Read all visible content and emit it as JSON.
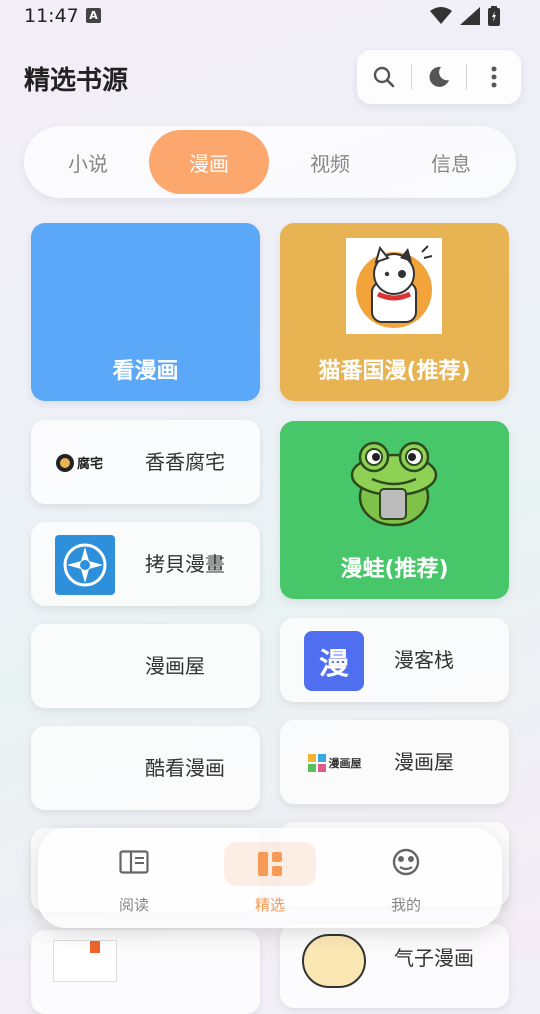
{
  "status": {
    "time": "11:47",
    "badge": "A"
  },
  "header": {
    "title": "精选书源"
  },
  "toolbar": {
    "search_icon": "search-icon",
    "theme_icon": "moon-icon",
    "more_icon": "more-vertical-icon"
  },
  "tabs": [
    {
      "label": "小说",
      "active": false
    },
    {
      "label": "漫画",
      "active": true
    },
    {
      "label": "视频",
      "active": false
    },
    {
      "label": "信息",
      "active": false
    }
  ],
  "cards": {
    "kanmanhua": {
      "label": "看漫画",
      "color": "#5aa8f7"
    },
    "maofan": {
      "label": "猫番国漫(推荐)",
      "color": "#e8b352"
    },
    "xiangxiang": {
      "label": "香香腐宅",
      "logo_text": "腐宅"
    },
    "manwa": {
      "label": "漫蛙(推荐)",
      "color": "#48c76a"
    },
    "kaobei": {
      "label": "拷貝漫畫"
    },
    "manhuawu1": {
      "label": "漫画屋"
    },
    "mankezhan": {
      "label": "漫客栈",
      "logo_text": "漫",
      "color": "#4f6ff0"
    },
    "kukan": {
      "label": "酷看漫画"
    },
    "manhuawu2": {
      "label": "漫画屋",
      "logo_text": "漫画屋"
    },
    "partial": {
      "label": "气子漫画"
    }
  },
  "nav": [
    {
      "label": "阅读",
      "icon": "book-icon",
      "active": false
    },
    {
      "label": "精选",
      "icon": "grid-icon",
      "active": true
    },
    {
      "label": "我的",
      "icon": "profile-icon",
      "active": false
    }
  ],
  "colors": {
    "accent": "#fca76e",
    "accent_text": "#f79a55"
  }
}
